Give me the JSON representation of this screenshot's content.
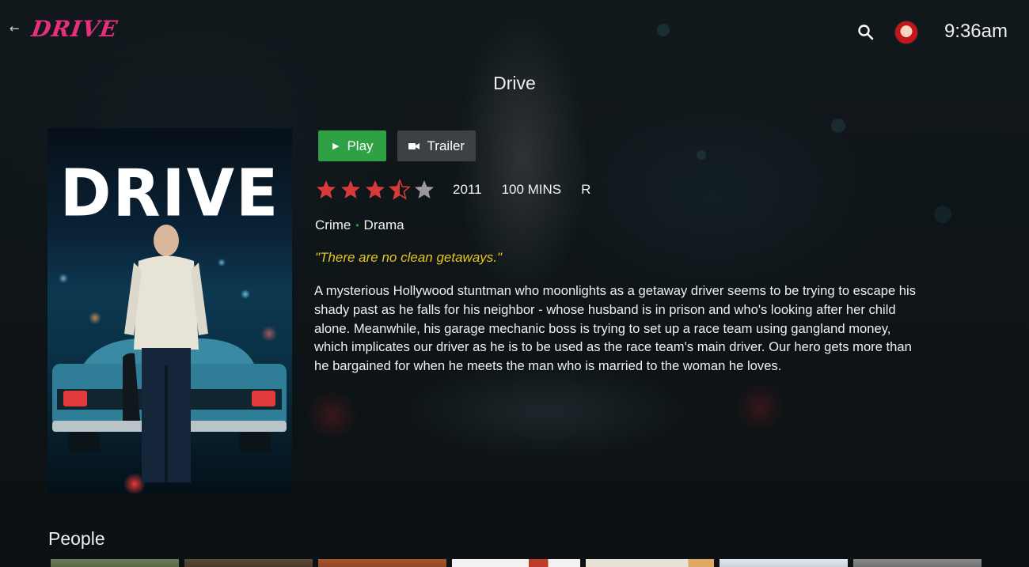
{
  "app": {
    "logo_text": "DRIVE",
    "back_icon": "arrow-left-icon",
    "search_icon": "search-icon",
    "clock": "9:36am"
  },
  "movie": {
    "title": "Drive",
    "poster_title": "DRIVE",
    "actions": {
      "play_label": "Play",
      "play_icon": "play-icon",
      "trailer_label": "Trailer",
      "trailer_icon": "video-camera-icon"
    },
    "rating": {
      "stars_max": 5,
      "stars_value": 3.5,
      "star_color": "#d63a3a",
      "empty_star_color": "#9a9a9a"
    },
    "year": "2011",
    "runtime": "100 MINS",
    "content_rating": "R",
    "genres": [
      "Crime",
      "Drama"
    ],
    "genre_separator": "•",
    "tagline": "\"There are no clean getaways.\"",
    "summary": "A mysterious Hollywood stuntman who moonlights as a getaway driver seems to be trying to escape his shady past as he falls for his neighbor - whose husband is in prison and who's looking after her child alone. Meanwhile, his garage mechanic boss is trying to set up a race team using gangland money, which implicates our driver as he is to be used as the race team's main driver. Our hero gets more than he bargained for when he meets the man who is married to the woman he loves."
  },
  "people": {
    "section_title": "People",
    "count_visible": 7
  },
  "colors": {
    "accent_green": "#2fa043",
    "logo_pink": "#e8307a",
    "tagline_yellow": "#e8c619"
  }
}
